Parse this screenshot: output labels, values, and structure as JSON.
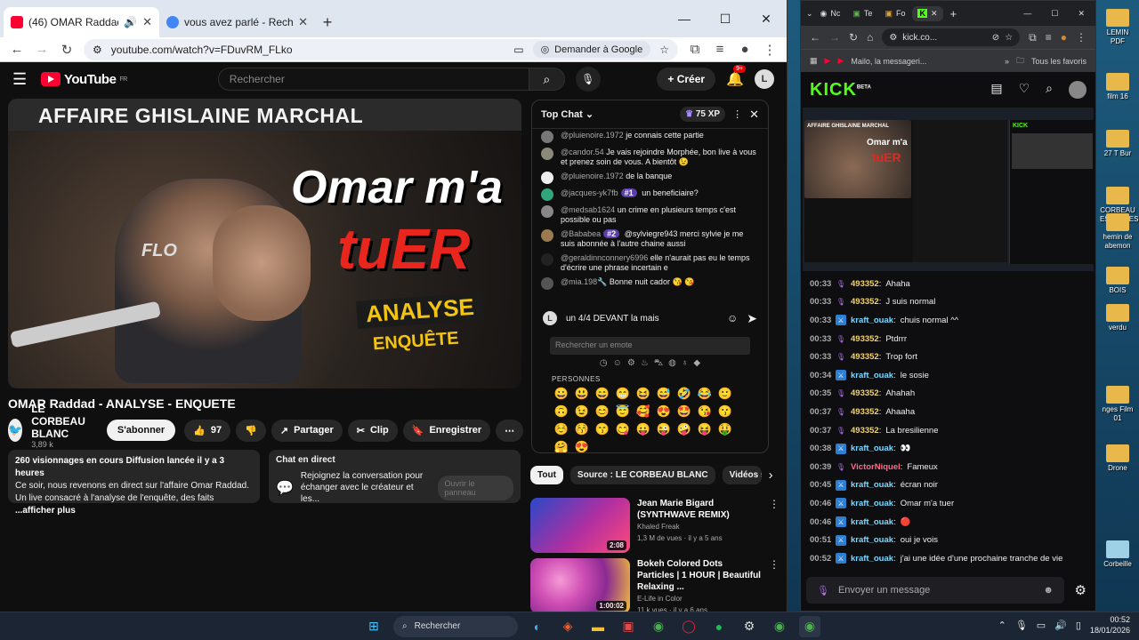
{
  "left_browser": {
    "tabs": [
      {
        "title": "(46) OMAR Raddad - ANALYS",
        "favicon_color": "#ff0033",
        "active": true
      },
      {
        "title": "vous avez parlé - Recherche Go",
        "favicon_color": "#4285f4",
        "active": false
      }
    ],
    "url": "youtube.com/watch?v=FDuvRM_FLko",
    "ask_google": "Demander à Google"
  },
  "youtube": {
    "logo": "YouTube",
    "region": "FR",
    "search_placeholder": "Rechercher",
    "create_label": "Créer",
    "notif_badge": "9+",
    "thumbnail": {
      "top_text": "AFFAIRE GHISLAINE MARCHAL",
      "big1": "Omar m'a",
      "big2": "tuER",
      "tag1": "ANALYSE",
      "tag2": "ENQUÊTE",
      "mic_text": "FLO"
    },
    "video_title": "OMAR Raddad - ANALYSE - ENQUETE",
    "channel_name": "LE CORBEAU BLANC",
    "subscribers": "3,89 k abonnés",
    "subscribe": "S'abonner",
    "likes": "97",
    "share": "Partager",
    "clip": "Clip",
    "save": "Enregistrer",
    "description": {
      "stats": "260 visionnages en cours  Diffusion lancée il y a 3 heures",
      "line1": "Ce soir, nous revenons en direct sur l'affaire Omar Raddad.",
      "line2": "Un live consacré à l'analyse de l'enquête, des faits",
      "more": "...afficher plus"
    },
    "live_chat_box": {
      "title": "Chat en direct",
      "text": "Rejoignez la conversation pour échanger avec le créateur et les...",
      "button": "Ouvrir le panneau"
    },
    "chat": {
      "mode": "Top Chat",
      "xp": "75 XP",
      "messages": [
        {
          "author": "@pluienoire.1972",
          "rank": "",
          "text": "je connais cette partie",
          "color": "#777"
        },
        {
          "author": "@candor.54",
          "rank": "",
          "text": "Je vais rejoindre Morphée, bon live à vous et prenez soin de vous. A bientôt 😉",
          "color": "#8a8a7a"
        },
        {
          "author": "@pluienoire.1972",
          "rank": "",
          "text": "de la banque",
          "color": "#eee"
        },
        {
          "author": "@jacques-yk7fb",
          "rank": "#1",
          "text": "un beneficiaire?",
          "color": "#31a57c"
        },
        {
          "author": "@medsab1624",
          "rank": "",
          "text": "un crime en plusieurs temps c'est possible ou pas",
          "color": "#888"
        },
        {
          "author": "@Bababea",
          "rank": "#2",
          "text": "@sylviegre943 merci sylvie je me suis abonnée à l'autre chaine aussi",
          "color": "#9c7a4f"
        },
        {
          "author": "@geraldinnconnery6996",
          "rank": "",
          "text": "elle n'aurait pas eu le temps d'écrire une phrase incertain e",
          "color": "#222"
        },
        {
          "author": "@mia.198🔧",
          "rank": "",
          "text": "Bonne nuit cador 😘 😘",
          "color": "#555"
        }
      ],
      "input_value": "un 4/4 DEVANT la mais",
      "emoji_search": "Rechercher un emote",
      "emoji_section": "PERSONNES",
      "emojis": [
        "😀",
        "😃",
        "😄",
        "😁",
        "😆",
        "😅",
        "🤣",
        "😂",
        "🙂",
        "🙃",
        "😉",
        "😊",
        "😇",
        "🥰",
        "😍",
        "🤩",
        "😘",
        "😗",
        "☺️",
        "😚",
        "😙",
        "😋",
        "😛",
        "😜",
        "🤪",
        "😝",
        "🤑",
        "🤗",
        "😍"
      ]
    },
    "chips": [
      "Tout",
      "Source : LE CORBEAU BLANC",
      "Vidéos si"
    ],
    "related": [
      {
        "title": "Jean Marie Bigard (SYNTHWAVE REMIX)",
        "channel": "Khaled Freak",
        "meta": "1,3 M de vues · il y a 5 ans",
        "duration": "2:08"
      },
      {
        "title": "Bokeh Colored Dots Particles | 1 HOUR | Beautiful Relaxing ...",
        "channel": "E-Life in Color",
        "meta": "11 k vues · il y a 6 ans",
        "duration": "1:00:02"
      }
    ]
  },
  "right_browser": {
    "tabs": [
      "Nc",
      "Te",
      "Fo",
      ""
    ],
    "url": "kick.co...",
    "bookmarks": [
      "Mailo, la messageri...",
      "Tous les favoris"
    ],
    "kick_logo": "KICK",
    "beta": "BETA",
    "preview": {
      "top_text": "AFFAIRE GHISLAINE MARCHAL",
      "big1": "Omar m'a",
      "big2": "tuER",
      "kick": "KICK"
    },
    "messages": [
      {
        "time": "00:33",
        "user": "493352",
        "text": "Ahaha",
        "ucolor": "#f3d36b",
        "badge": "mic"
      },
      {
        "time": "00:33",
        "user": "493352",
        "text": "J suis normal",
        "ucolor": "#f3d36b",
        "badge": "mic"
      },
      {
        "time": "00:33",
        "user": "kraft_ouak",
        "text": "chuis normal ^^",
        "ucolor": "#7ad9ff",
        "badge": "sword"
      },
      {
        "time": "00:33",
        "user": "493352",
        "text": "Ptdrrr",
        "ucolor": "#f3d36b",
        "badge": "mic"
      },
      {
        "time": "00:33",
        "user": "493352",
        "text": "Trop fort",
        "ucolor": "#f3d36b",
        "badge": "mic"
      },
      {
        "time": "00:34",
        "user": "kraft_ouak",
        "text": "le sosie",
        "ucolor": "#7ad9ff",
        "badge": "sword"
      },
      {
        "time": "00:35",
        "user": "493352",
        "text": "Ahahah",
        "ucolor": "#f3d36b",
        "badge": "mic"
      },
      {
        "time": "00:37",
        "user": "493352",
        "text": "Ahaaha",
        "ucolor": "#f3d36b",
        "badge": "mic"
      },
      {
        "time": "00:37",
        "user": "493352",
        "text": "La bresilienne",
        "ucolor": "#f3d36b",
        "badge": "mic"
      },
      {
        "time": "00:38",
        "user": "kraft_ouak",
        "text": "👀",
        "ucolor": "#7ad9ff",
        "badge": "sword"
      },
      {
        "time": "00:39",
        "user": "VictorNiquel",
        "text": "Fameux",
        "ucolor": "#ff6b8b",
        "badge": "mic"
      },
      {
        "time": "00:45",
        "user": "kraft_ouak",
        "text": "écran noir",
        "ucolor": "#7ad9ff",
        "badge": "sword"
      },
      {
        "time": "00:46",
        "user": "kraft_ouak",
        "text": "Omar m'a tuer",
        "ucolor": "#7ad9ff",
        "badge": "sword"
      },
      {
        "time": "00:46",
        "user": "kraft_ouak",
        "text": "🔴",
        "ucolor": "#7ad9ff",
        "badge": "sword"
      },
      {
        "time": "00:51",
        "user": "kraft_ouak",
        "text": "oui je vois",
        "ucolor": "#7ad9ff",
        "badge": "sword"
      },
      {
        "time": "00:52",
        "user": "kraft_ouak",
        "text": "j'ai une idée d'une prochaine tranche de vie",
        "ucolor": "#7ad9ff",
        "badge": "sword"
      }
    ],
    "input_placeholder": "Envoyer un message"
  },
  "desktop_icons": [
    "LEMIN PDF",
    "film 16",
    "27 T Bur",
    "CORBEAU ESPANGES",
    "hemin de abemon",
    "BOIS",
    "verdu",
    "nges Film 01",
    "Drone",
    "Corbeille"
  ],
  "taskbar": {
    "search": "Rechercher",
    "time": "00:52",
    "date": "18/01/2026"
  }
}
